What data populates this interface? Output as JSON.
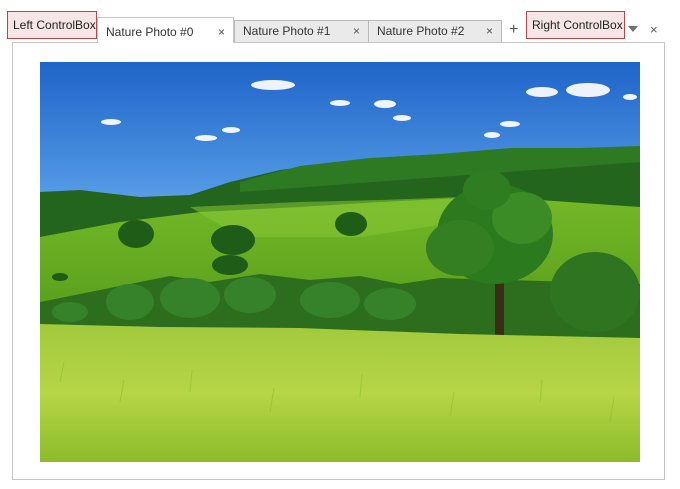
{
  "controlboxes": {
    "left_label": "Left ControlBox",
    "right_label": "Right ControlBox"
  },
  "tabs": [
    {
      "label": "Nature Photo #0",
      "active": true,
      "close_glyph": "×"
    },
    {
      "label": "Nature Photo #1",
      "active": false,
      "close_glyph": "×"
    },
    {
      "label": "Nature Photo #2",
      "active": false,
      "close_glyph": "×"
    }
  ],
  "tab_strip": {
    "add_glyph": "+",
    "close_all_glyph": "×",
    "dropdown_icon": "caret-down-icon"
  },
  "content": {
    "photo_icon": "nature-photo-image"
  },
  "colors": {
    "controlbox_border": "#b04a4a",
    "controlbox_bg": "#f6e6e6",
    "tab_bg": "#eaeaea",
    "tab_active_bg": "#ffffff"
  }
}
